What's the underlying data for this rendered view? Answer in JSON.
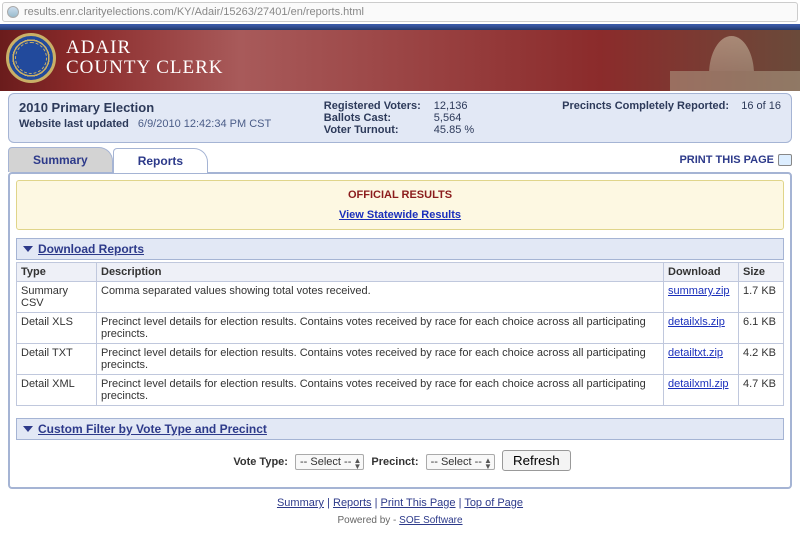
{
  "url": "results.enr.clarityelections.com/KY/Adair/15263/27401/en/reports.html",
  "site": {
    "title_line1": "ADAIR",
    "title_line2": "COUNTY CLERK"
  },
  "infobar": {
    "election_title": "2010 Primary Election",
    "updated_label": "Website last updated",
    "updated_time": "6/9/2010 12:42:34 PM CST",
    "stats": {
      "registered_label": "Registered Voters:",
      "registered_value": "12,136",
      "ballots_label": "Ballots Cast:",
      "ballots_value": "5,564",
      "turnout_label": "Voter Turnout:",
      "turnout_value": "45.85 %"
    },
    "precincts_label": "Precincts Completely Reported:",
    "precincts_value": "16 of 16"
  },
  "tabs": {
    "summary": "Summary",
    "reports": "Reports",
    "print": "PRINT THIS PAGE"
  },
  "official": {
    "title": "OFFICIAL RESULTS",
    "statewide_link": "View Statewide Results"
  },
  "sections": {
    "download": "Download Reports",
    "custom": "Custom Filter by Vote Type and Precinct"
  },
  "table": {
    "headers": {
      "type": "Type",
      "desc": "Description",
      "download": "Download",
      "size": "Size"
    },
    "rows": [
      {
        "type": "Summary CSV",
        "desc": "Comma separated values showing total votes received.",
        "link": "summary.zip",
        "size": "1.7 KB"
      },
      {
        "type": "Detail XLS",
        "desc": "Precinct level details for election results. Contains votes received by race for each choice across all participating precincts.",
        "link": "detailxls.zip",
        "size": "6.1 KB"
      },
      {
        "type": "Detail TXT",
        "desc": "Precinct level details for election results. Contains votes received by race for each choice across all participating precincts.",
        "link": "detailtxt.zip",
        "size": "4.2 KB"
      },
      {
        "type": "Detail XML",
        "desc": "Precinct level details for election results. Contains votes received by race for each choice across all participating precincts.",
        "link": "detailxml.zip",
        "size": "4.7 KB"
      }
    ]
  },
  "filter": {
    "vote_type_label": "Vote Type:",
    "vote_type_value": "-- Select --",
    "precinct_label": "Precinct:",
    "precinct_value": "-- Select --",
    "refresh": "Refresh"
  },
  "footer": {
    "links": {
      "summary": "Summary",
      "reports": "Reports",
      "print": "Print This Page",
      "top": "Top of Page"
    },
    "powered_label": "Powered by -",
    "powered_link": "SOE Software"
  }
}
